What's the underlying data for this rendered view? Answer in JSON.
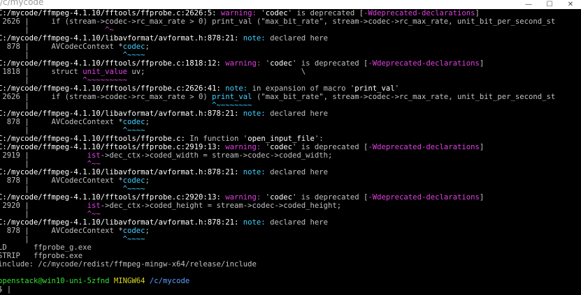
{
  "window": {
    "title": "/c/mycode",
    "controls": [
      "—",
      "☐",
      "✕"
    ]
  },
  "colors": {
    "background": "#000000",
    "text": "#c0c0c0",
    "bold": "#ffffff",
    "warning": "#e040e0",
    "note": "#40d0ff",
    "prompt_user": "#33e030",
    "prompt_env": "#d8d820",
    "prompt_path": "#5aa0ff"
  },
  "terminal": {
    "lines": [
      [
        {
          "t": "C:/mycode/ffmpeg-4.1.10/fftools/ffprobe.c:2626:5: ",
          "c": "w"
        },
        {
          "t": "warning: ",
          "c": "mg"
        },
        {
          "t": "'",
          "c": ""
        },
        {
          "t": "codec",
          "c": "w"
        },
        {
          "t": "' is deprecated [",
          "c": ""
        },
        {
          "t": "-Wdeprecated-declarations",
          "c": "mg"
        },
        {
          "t": "]",
          "c": ""
        }
      ],
      [
        {
          "t": " 2626 |     if (stream->codec->rc_max_rate > 0) print_val (\"max_bit_rate\", stream->codec->rc_max_rate, unit_bit_per_second_st",
          "c": ""
        }
      ],
      [
        {
          "t": "      |                 ",
          "c": ""
        },
        {
          "t": "^~",
          "c": "mg"
        }
      ],
      [
        {
          "t": "C:/mycode/ffmpeg-4.1.10/libavformat/avformat.h:878:21: ",
          "c": "w"
        },
        {
          "t": "note: ",
          "c": "cy"
        },
        {
          "t": "declared here",
          "c": ""
        }
      ],
      [
        {
          "t": "  878 |     AVCodecContext *",
          "c": ""
        },
        {
          "t": "codec",
          "c": "cy"
        },
        {
          "t": ";",
          "c": ""
        }
      ],
      [
        {
          "t": "      |                     ",
          "c": ""
        },
        {
          "t": "^~~~~",
          "c": "cy"
        }
      ],
      [
        {
          "t": "C:/mycode/ffmpeg-4.1.10/fftools/ffprobe.c:1818:12: ",
          "c": "w"
        },
        {
          "t": "warning: ",
          "c": "mg"
        },
        {
          "t": "'",
          "c": ""
        },
        {
          "t": "codec",
          "c": "w"
        },
        {
          "t": "' is deprecated [",
          "c": ""
        },
        {
          "t": "-Wdeprecated-declarations",
          "c": "mg"
        },
        {
          "t": "]",
          "c": ""
        }
      ],
      [
        {
          "t": " 1818 |     struct ",
          "c": ""
        },
        {
          "t": "unit_value",
          "c": "mg"
        },
        {
          "t": " uv;                                   \\",
          "c": ""
        }
      ],
      [
        {
          "t": "      |            ",
          "c": ""
        },
        {
          "t": "^~~~~~~~~~",
          "c": "mg"
        }
      ],
      [
        {
          "t": "C:/mycode/ffmpeg-4.1.10/fftools/ffprobe.c:2626:41: ",
          "c": "w"
        },
        {
          "t": "note: ",
          "c": "cy"
        },
        {
          "t": "in expansion of macro '",
          "c": ""
        },
        {
          "t": "print_val",
          "c": "w"
        },
        {
          "t": "'",
          "c": ""
        }
      ],
      [
        {
          "t": " 2626 |     if (stream->codec->rc_max_rate > 0) ",
          "c": ""
        },
        {
          "t": "print_val",
          "c": "cy"
        },
        {
          "t": " (\"max_bit_rate\", stream->codec->rc_max_rate, unit_bit_per_second_st",
          "c": ""
        }
      ],
      [
        {
          "t": "      |                                         ",
          "c": ""
        },
        {
          "t": "^~~~~~~~~",
          "c": "cy"
        }
      ],
      [
        {
          "t": "C:/mycode/ffmpeg-4.1.10/libavformat/avformat.h:878:21: ",
          "c": "w"
        },
        {
          "t": "note: ",
          "c": "cy"
        },
        {
          "t": "declared here",
          "c": ""
        }
      ],
      [
        {
          "t": "  878 |     AVCodecContext *",
          "c": ""
        },
        {
          "t": "codec",
          "c": "cy"
        },
        {
          "t": ";",
          "c": ""
        }
      ],
      [
        {
          "t": "      |                     ",
          "c": ""
        },
        {
          "t": "^~~~~",
          "c": "cy"
        }
      ],
      [
        {
          "t": "C:/mycode/ffmpeg-4.1.10/fftools/ffprobe.c: ",
          "c": "w"
        },
        {
          "t": "In function '",
          "c": ""
        },
        {
          "t": "open_input_file",
          "c": "w"
        },
        {
          "t": "':",
          "c": ""
        }
      ],
      [
        {
          "t": "C:/mycode/ffmpeg-4.1.10/fftools/ffprobe.c:2919:13: ",
          "c": "w"
        },
        {
          "t": "warning: ",
          "c": "mg"
        },
        {
          "t": "'",
          "c": ""
        },
        {
          "t": "codec",
          "c": "w"
        },
        {
          "t": "' is deprecated [",
          "c": ""
        },
        {
          "t": "-Wdeprecated-declarations",
          "c": "mg"
        },
        {
          "t": "]",
          "c": ""
        }
      ],
      [
        {
          "t": " 2919 |             ",
          "c": ""
        },
        {
          "t": "ist",
          "c": "mg"
        },
        {
          "t": "->dec_ctx->coded_width = stream->codec->coded_width;",
          "c": ""
        }
      ],
      [
        {
          "t": "      |             ",
          "c": ""
        },
        {
          "t": "^~~",
          "c": "mg"
        }
      ],
      [
        {
          "t": "C:/mycode/ffmpeg-4.1.10/libavformat/avformat.h:878:21: ",
          "c": "w"
        },
        {
          "t": "note: ",
          "c": "cy"
        },
        {
          "t": "declared here",
          "c": ""
        }
      ],
      [
        {
          "t": "  878 |     AVCodecContext *",
          "c": ""
        },
        {
          "t": "codec",
          "c": "cy"
        },
        {
          "t": ";",
          "c": ""
        }
      ],
      [
        {
          "t": "      |                     ",
          "c": ""
        },
        {
          "t": "^~~~~",
          "c": "cy"
        }
      ],
      [
        {
          "t": "C:/mycode/ffmpeg-4.1.10/fftools/ffprobe.c:2920:13: ",
          "c": "w"
        },
        {
          "t": "warning: ",
          "c": "mg"
        },
        {
          "t": "'",
          "c": ""
        },
        {
          "t": "codec",
          "c": "w"
        },
        {
          "t": "' is deprecated [",
          "c": ""
        },
        {
          "t": "-Wdeprecated-declarations",
          "c": "mg"
        },
        {
          "t": "]",
          "c": ""
        }
      ],
      [
        {
          "t": " 2920 |             ",
          "c": ""
        },
        {
          "t": "ist",
          "c": "mg"
        },
        {
          "t": "->dec_ctx->coded_height = stream->codec->coded_height;",
          "c": ""
        }
      ],
      [
        {
          "t": "      |             ",
          "c": ""
        },
        {
          "t": "^~~",
          "c": "mg"
        }
      ],
      [
        {
          "t": "C:/mycode/ffmpeg-4.1.10/libavformat/avformat.h:878:21: ",
          "c": "w"
        },
        {
          "t": "note: ",
          "c": "cy"
        },
        {
          "t": "declared here",
          "c": ""
        }
      ],
      [
        {
          "t": "  878 |     AVCodecContext *",
          "c": ""
        },
        {
          "t": "codec",
          "c": "cy"
        },
        {
          "t": ";",
          "c": ""
        }
      ],
      [
        {
          "t": "      |                     ",
          "c": ""
        },
        {
          "t": "^~~~~",
          "c": "cy"
        }
      ],
      [
        {
          "t": "LD      ffprobe_g.exe",
          "c": ""
        }
      ],
      [
        {
          "t": "STRIP   ffprobe.exe",
          "c": ""
        }
      ],
      [
        {
          "t": "include: /c/mycode/redist/ffmpeg-mingw-x64/release/include",
          "c": ""
        }
      ],
      [
        {
          "t": "",
          "c": ""
        }
      ],
      [
        {
          "t": "openstack@win10-uni-5zfnd ",
          "c": "gr"
        },
        {
          "t": "MINGW64 ",
          "c": "yl"
        },
        {
          "t": "/c/mycode",
          "c": "bl"
        }
      ],
      [
        {
          "t": "$ ",
          "c": ""
        },
        {
          "t": "|",
          "c": "cursor-cell"
        }
      ]
    ]
  }
}
